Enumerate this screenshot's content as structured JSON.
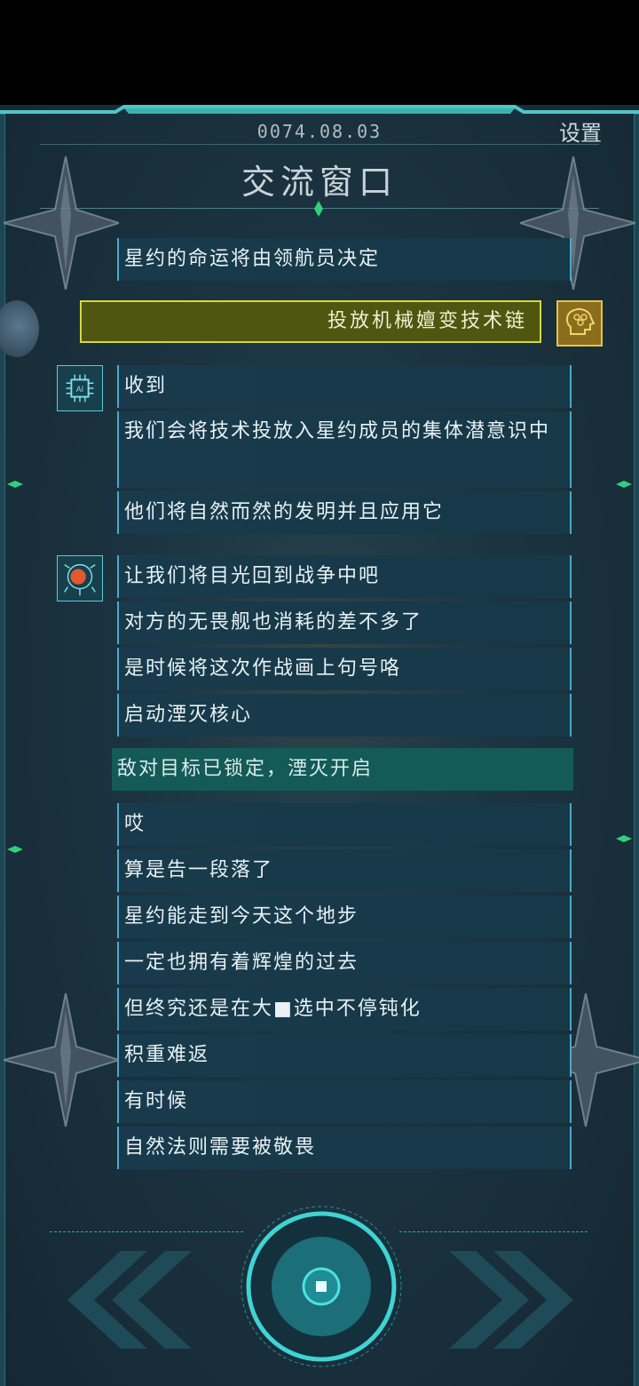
{
  "header": {
    "date": "0074.08.03",
    "settings_label": "设置",
    "title": "交流窗口"
  },
  "messages_top": [
    {
      "text": "星约的命运将由领航员决定"
    }
  ],
  "player_message": {
    "text": "投放机械嬗变技术链",
    "avatar_icon": "brain-head-icon"
  },
  "ai_block": {
    "avatar_icon": "ai-chip-icon",
    "messages": [
      {
        "text": "收到"
      },
      {
        "text": "我们会将技术投放入星约成员的集体潜意识中"
      },
      {
        "text": "他们将自然而然的发明并且应用它"
      }
    ]
  },
  "brain_block": {
    "avatar_icon": "circuit-brain-icon",
    "messages": [
      {
        "text": "让我们将目光回到战争中吧"
      },
      {
        "text": "对方的无畏舰也消耗的差不多了"
      },
      {
        "text": "是时候将这次作战画上句号咯"
      },
      {
        "text": "启动湮灭核心"
      }
    ]
  },
  "system_message": {
    "text": "敌对目标已锁定，湮灭开启"
  },
  "later_messages": [
    {
      "text": "哎"
    },
    {
      "text": "算是告一段落了"
    },
    {
      "text": "星约能走到今天这个地步"
    },
    {
      "text": "一定也拥有着辉煌的过去"
    },
    {
      "text": "但终究还是在大■选中不停钝化"
    },
    {
      "text": "积重难返"
    },
    {
      "text": "有时候"
    },
    {
      "text": "自然法则需要被敬畏"
    }
  ],
  "controls": {
    "prev_icon": "double-chevron-left-icon",
    "next_icon": "double-chevron-right-icon",
    "center_icon": "stop-square-icon"
  },
  "colors": {
    "accent": "#4aa9c9",
    "highlight": "#145a57",
    "player_bg": "#4f5610",
    "player_border": "#d5d93a"
  }
}
